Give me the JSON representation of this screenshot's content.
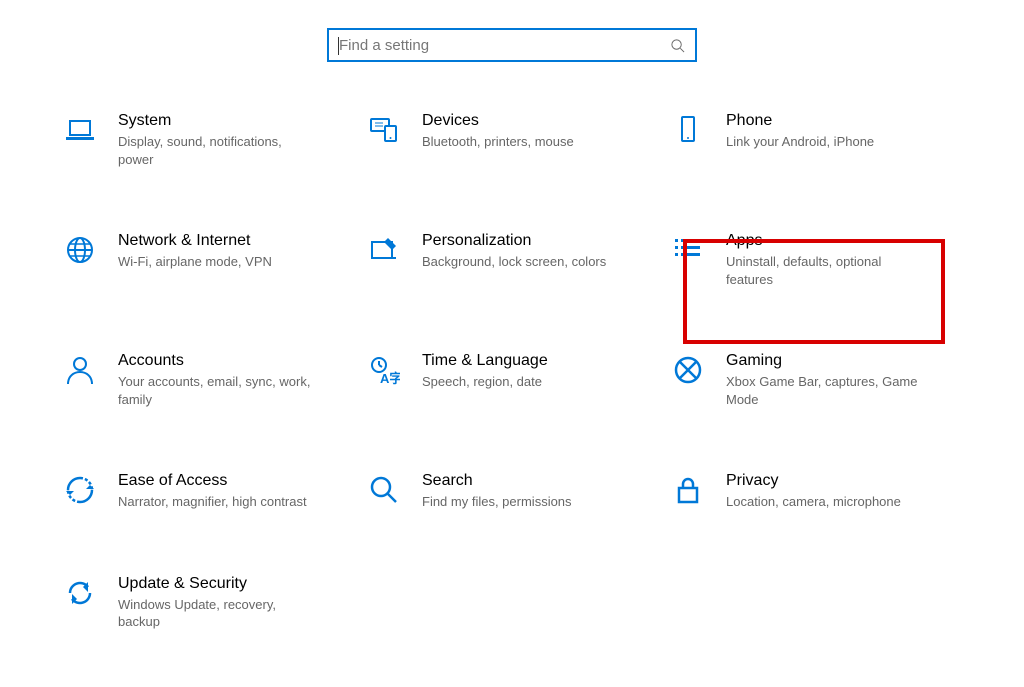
{
  "search": {
    "placeholder": "Find a setting"
  },
  "tiles": [
    {
      "id": "system",
      "title": "System",
      "desc": "Display, sound, notifications, power"
    },
    {
      "id": "devices",
      "title": "Devices",
      "desc": "Bluetooth, printers, mouse"
    },
    {
      "id": "phone",
      "title": "Phone",
      "desc": "Link your Android, iPhone"
    },
    {
      "id": "network",
      "title": "Network & Internet",
      "desc": "Wi-Fi, airplane mode, VPN"
    },
    {
      "id": "personalization",
      "title": "Personalization",
      "desc": "Background, lock screen, colors"
    },
    {
      "id": "apps",
      "title": "Apps",
      "desc": "Uninstall, defaults, optional features"
    },
    {
      "id": "accounts",
      "title": "Accounts",
      "desc": "Your accounts, email, sync, work, family"
    },
    {
      "id": "time",
      "title": "Time & Language",
      "desc": "Speech, region, date"
    },
    {
      "id": "gaming",
      "title": "Gaming",
      "desc": "Xbox Game Bar, captures, Game Mode"
    },
    {
      "id": "ease",
      "title": "Ease of Access",
      "desc": "Narrator, magnifier, high contrast"
    },
    {
      "id": "search",
      "title": "Search",
      "desc": "Find my files, permissions"
    },
    {
      "id": "privacy",
      "title": "Privacy",
      "desc": "Location, camera, microphone"
    },
    {
      "id": "update",
      "title": "Update & Security",
      "desc": "Windows Update, recovery, backup"
    }
  ],
  "highlight": {
    "tile_id": "apps"
  }
}
